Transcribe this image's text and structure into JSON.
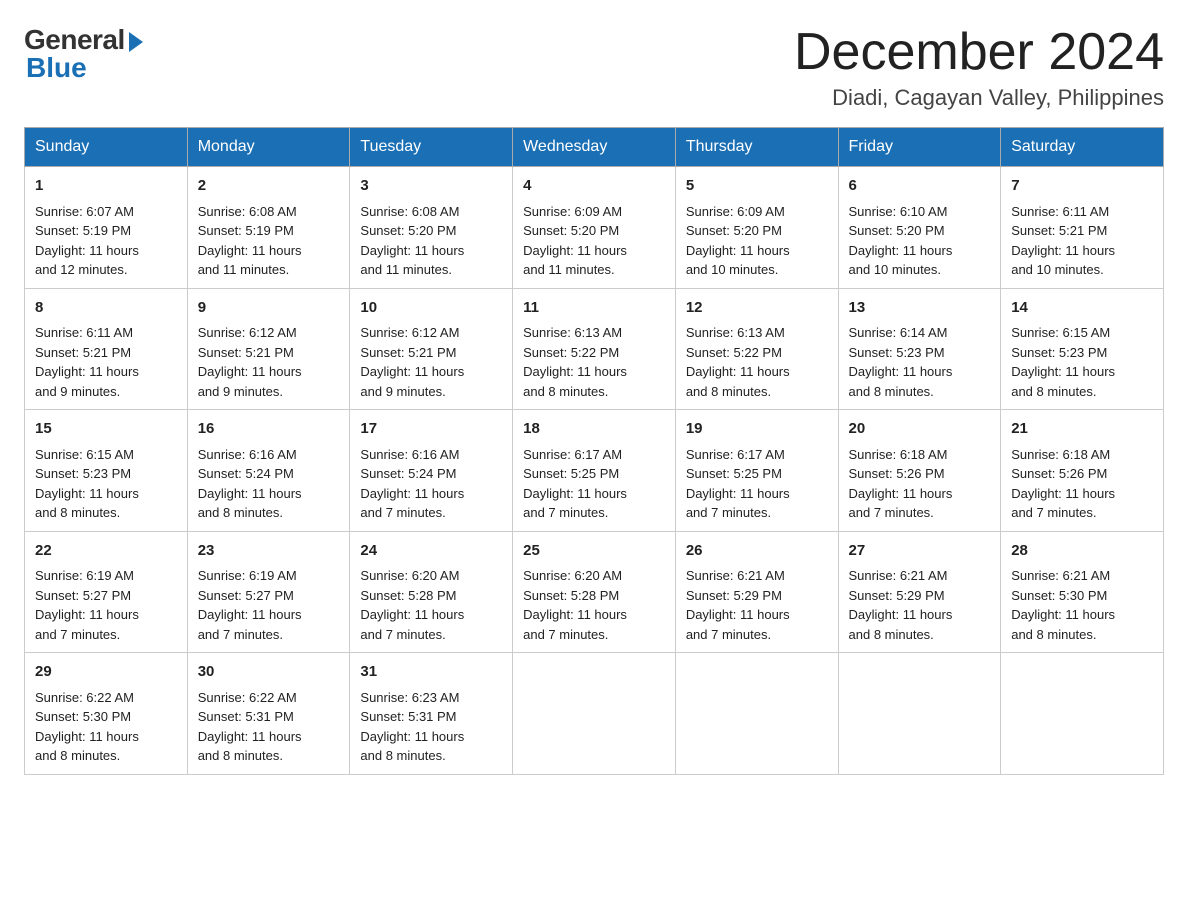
{
  "logo": {
    "general": "General",
    "blue": "Blue"
  },
  "header": {
    "title": "December 2024",
    "subtitle": "Diadi, Cagayan Valley, Philippines"
  },
  "weekdays": [
    "Sunday",
    "Monday",
    "Tuesday",
    "Wednesday",
    "Thursday",
    "Friday",
    "Saturday"
  ],
  "weeks": [
    [
      {
        "day": "1",
        "sunrise": "6:07 AM",
        "sunset": "5:19 PM",
        "daylight": "11 hours and 12 minutes."
      },
      {
        "day": "2",
        "sunrise": "6:08 AM",
        "sunset": "5:19 PM",
        "daylight": "11 hours and 11 minutes."
      },
      {
        "day": "3",
        "sunrise": "6:08 AM",
        "sunset": "5:20 PM",
        "daylight": "11 hours and 11 minutes."
      },
      {
        "day": "4",
        "sunrise": "6:09 AM",
        "sunset": "5:20 PM",
        "daylight": "11 hours and 11 minutes."
      },
      {
        "day": "5",
        "sunrise": "6:09 AM",
        "sunset": "5:20 PM",
        "daylight": "11 hours and 10 minutes."
      },
      {
        "day": "6",
        "sunrise": "6:10 AM",
        "sunset": "5:20 PM",
        "daylight": "11 hours and 10 minutes."
      },
      {
        "day": "7",
        "sunrise": "6:11 AM",
        "sunset": "5:21 PM",
        "daylight": "11 hours and 10 minutes."
      }
    ],
    [
      {
        "day": "8",
        "sunrise": "6:11 AM",
        "sunset": "5:21 PM",
        "daylight": "11 hours and 9 minutes."
      },
      {
        "day": "9",
        "sunrise": "6:12 AM",
        "sunset": "5:21 PM",
        "daylight": "11 hours and 9 minutes."
      },
      {
        "day": "10",
        "sunrise": "6:12 AM",
        "sunset": "5:21 PM",
        "daylight": "11 hours and 9 minutes."
      },
      {
        "day": "11",
        "sunrise": "6:13 AM",
        "sunset": "5:22 PM",
        "daylight": "11 hours and 8 minutes."
      },
      {
        "day": "12",
        "sunrise": "6:13 AM",
        "sunset": "5:22 PM",
        "daylight": "11 hours and 8 minutes."
      },
      {
        "day": "13",
        "sunrise": "6:14 AM",
        "sunset": "5:23 PM",
        "daylight": "11 hours and 8 minutes."
      },
      {
        "day": "14",
        "sunrise": "6:15 AM",
        "sunset": "5:23 PM",
        "daylight": "11 hours and 8 minutes."
      }
    ],
    [
      {
        "day": "15",
        "sunrise": "6:15 AM",
        "sunset": "5:23 PM",
        "daylight": "11 hours and 8 minutes."
      },
      {
        "day": "16",
        "sunrise": "6:16 AM",
        "sunset": "5:24 PM",
        "daylight": "11 hours and 8 minutes."
      },
      {
        "day": "17",
        "sunrise": "6:16 AM",
        "sunset": "5:24 PM",
        "daylight": "11 hours and 7 minutes."
      },
      {
        "day": "18",
        "sunrise": "6:17 AM",
        "sunset": "5:25 PM",
        "daylight": "11 hours and 7 minutes."
      },
      {
        "day": "19",
        "sunrise": "6:17 AM",
        "sunset": "5:25 PM",
        "daylight": "11 hours and 7 minutes."
      },
      {
        "day": "20",
        "sunrise": "6:18 AM",
        "sunset": "5:26 PM",
        "daylight": "11 hours and 7 minutes."
      },
      {
        "day": "21",
        "sunrise": "6:18 AM",
        "sunset": "5:26 PM",
        "daylight": "11 hours and 7 minutes."
      }
    ],
    [
      {
        "day": "22",
        "sunrise": "6:19 AM",
        "sunset": "5:27 PM",
        "daylight": "11 hours and 7 minutes."
      },
      {
        "day": "23",
        "sunrise": "6:19 AM",
        "sunset": "5:27 PM",
        "daylight": "11 hours and 7 minutes."
      },
      {
        "day": "24",
        "sunrise": "6:20 AM",
        "sunset": "5:28 PM",
        "daylight": "11 hours and 7 minutes."
      },
      {
        "day": "25",
        "sunrise": "6:20 AM",
        "sunset": "5:28 PM",
        "daylight": "11 hours and 7 minutes."
      },
      {
        "day": "26",
        "sunrise": "6:21 AM",
        "sunset": "5:29 PM",
        "daylight": "11 hours and 7 minutes."
      },
      {
        "day": "27",
        "sunrise": "6:21 AM",
        "sunset": "5:29 PM",
        "daylight": "11 hours and 8 minutes."
      },
      {
        "day": "28",
        "sunrise": "6:21 AM",
        "sunset": "5:30 PM",
        "daylight": "11 hours and 8 minutes."
      }
    ],
    [
      {
        "day": "29",
        "sunrise": "6:22 AM",
        "sunset": "5:30 PM",
        "daylight": "11 hours and 8 minutes."
      },
      {
        "day": "30",
        "sunrise": "6:22 AM",
        "sunset": "5:31 PM",
        "daylight": "11 hours and 8 minutes."
      },
      {
        "day": "31",
        "sunrise": "6:23 AM",
        "sunset": "5:31 PM",
        "daylight": "11 hours and 8 minutes."
      },
      null,
      null,
      null,
      null
    ]
  ],
  "labels": {
    "sunrise": "Sunrise:",
    "sunset": "Sunset:",
    "daylight": "Daylight:"
  }
}
